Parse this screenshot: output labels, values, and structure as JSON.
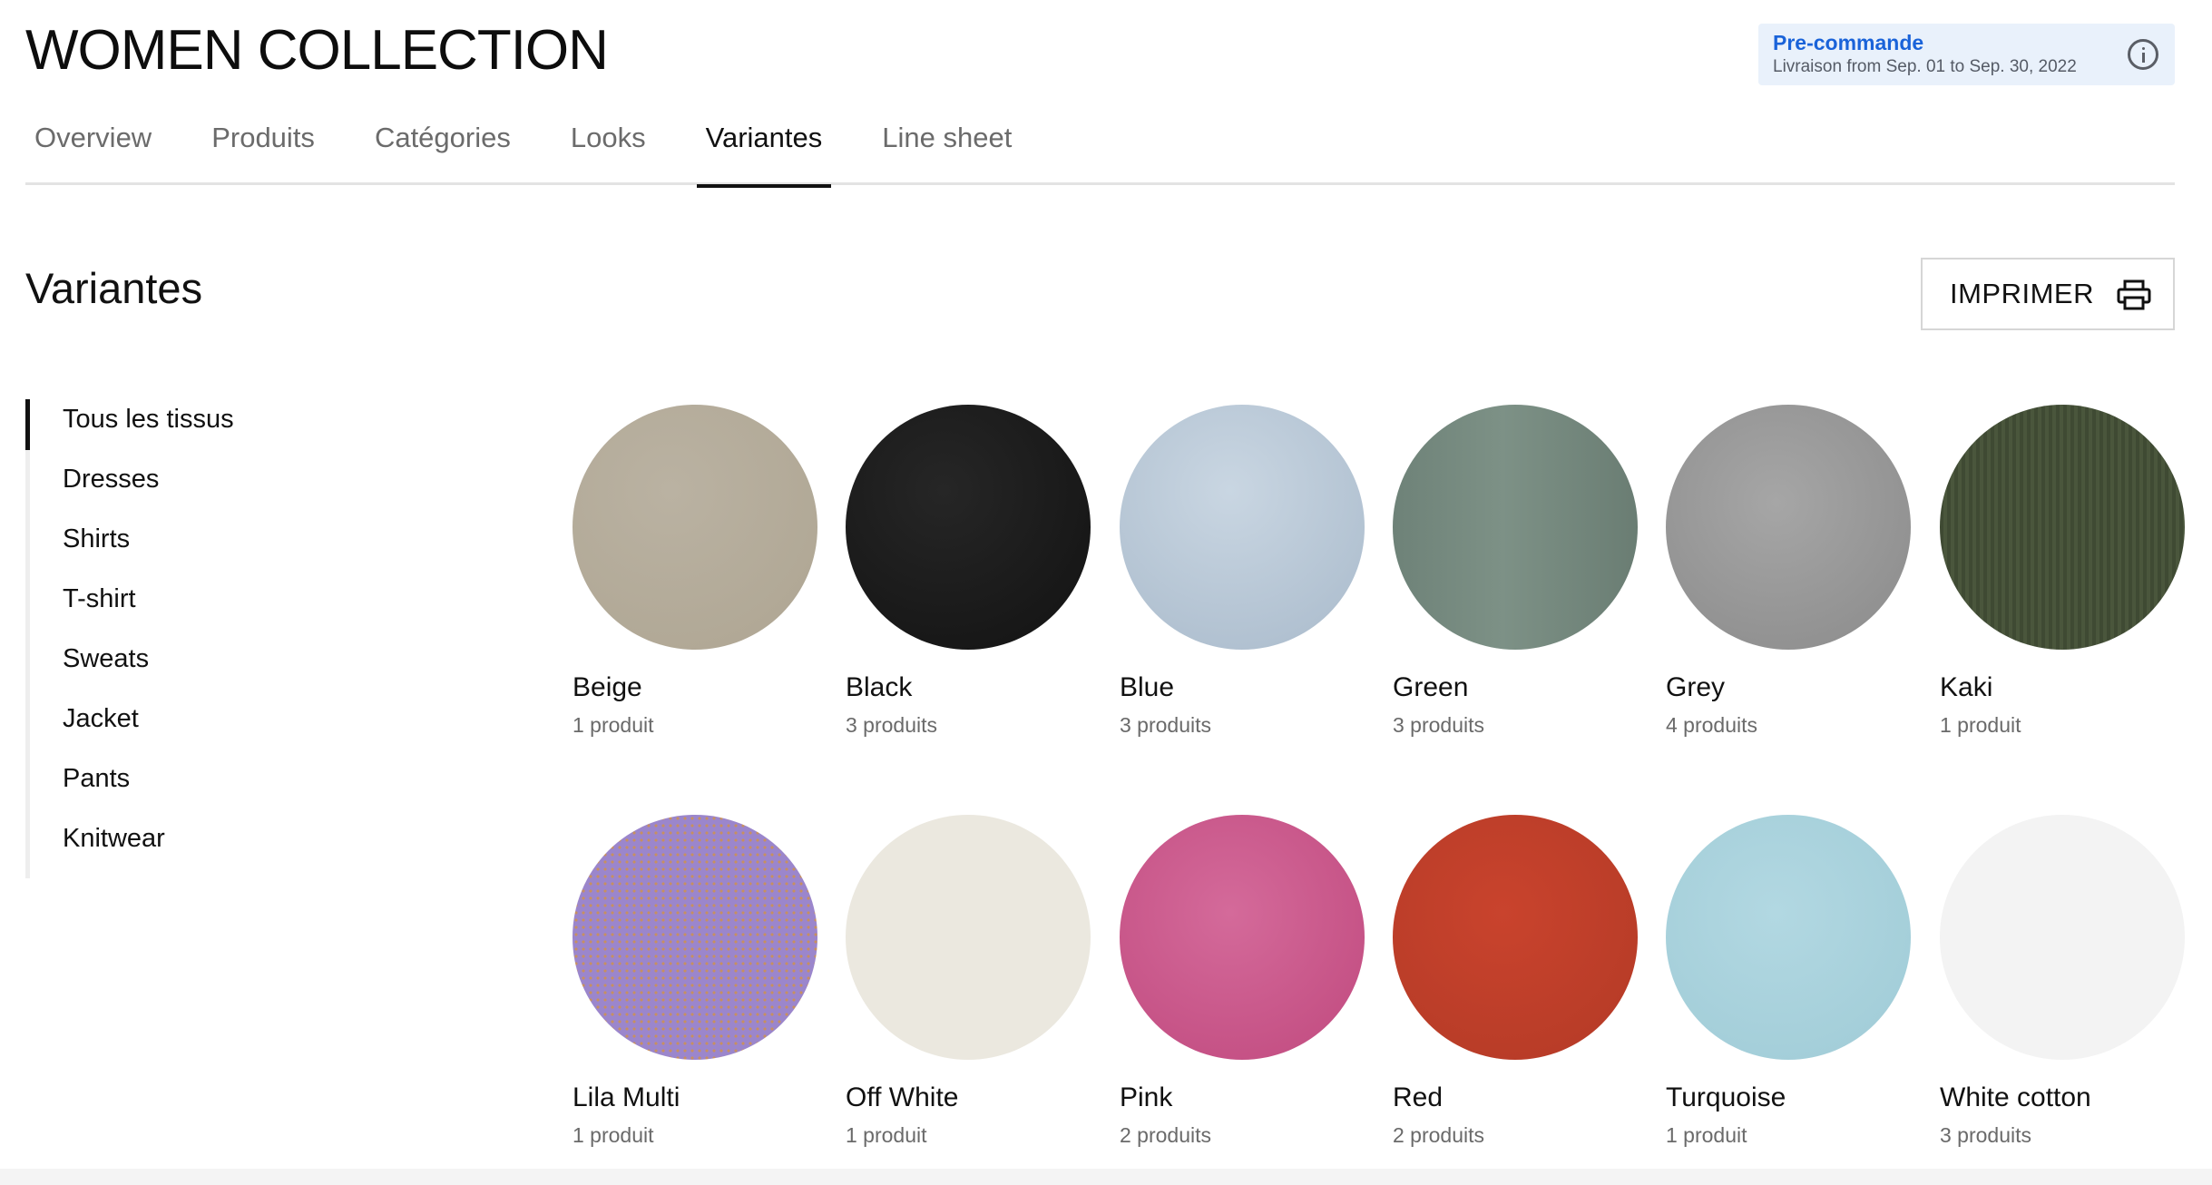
{
  "header": {
    "title": "WOMEN COLLECTION",
    "preorder": {
      "title": "Pre-commande",
      "subtitle": "Livraison from Sep. 01 to Sep. 30, 2022",
      "icon": "info-icon"
    }
  },
  "tabs": [
    {
      "label": "Overview"
    },
    {
      "label": "Produits"
    },
    {
      "label": "Catégories"
    },
    {
      "label": "Looks"
    },
    {
      "label": "Variantes",
      "active": true
    },
    {
      "label": "Line sheet"
    }
  ],
  "section": {
    "title": "Variantes",
    "print_label": "IMPRIMER",
    "print_icon": "printer-icon"
  },
  "sidebar": {
    "items": [
      {
        "label": "Tous les tissus",
        "active": true
      },
      {
        "label": "Dresses"
      },
      {
        "label": "Shirts"
      },
      {
        "label": "T-shirt"
      },
      {
        "label": "Sweats"
      },
      {
        "label": "Jacket"
      },
      {
        "label": "Pants"
      },
      {
        "label": "Knitwear"
      }
    ]
  },
  "variants": [
    {
      "name": "Beige",
      "count": "1 produit",
      "color": "#b4ab99"
    },
    {
      "name": "Black",
      "count": "3 produits",
      "color": "#1a1a1a"
    },
    {
      "name": "Blue",
      "count": "3 produits",
      "color": "#b8c8d8"
    },
    {
      "name": "Green",
      "count": "3 produits",
      "color": "#74877d"
    },
    {
      "name": "Grey",
      "count": "4 produits",
      "color": "#999999"
    },
    {
      "name": "Kaki",
      "count": "1 produit",
      "color": "#434e37"
    },
    {
      "name": "Lila Multi",
      "count": "1 produit",
      "color": "#9b86cc"
    },
    {
      "name": "Off White",
      "count": "1 produit",
      "color": "#ebe8df"
    },
    {
      "name": "Pink",
      "count": "2 produits",
      "color": "#cc5a8c"
    },
    {
      "name": "Red",
      "count": "2 produits",
      "color": "#c13f2a"
    },
    {
      "name": "Turquoise",
      "count": "1 produit",
      "color": "#a8d1dc"
    },
    {
      "name": "White cotton",
      "count": "3 produits",
      "color": "#f3f3f3"
    }
  ]
}
